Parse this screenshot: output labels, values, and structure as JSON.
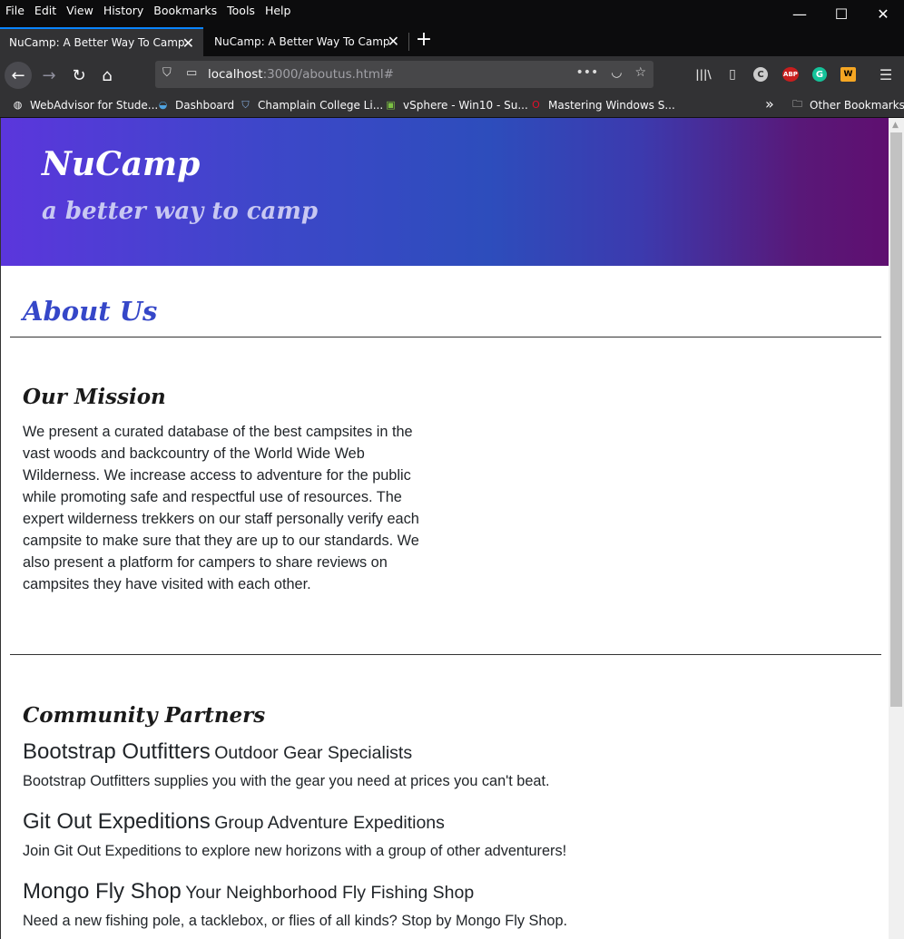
{
  "menu": [
    "File",
    "Edit",
    "View",
    "History",
    "Bookmarks",
    "Tools",
    "Help"
  ],
  "window_controls": {
    "minimize": "—",
    "maximize": "☐",
    "close": "✕"
  },
  "tabs": [
    {
      "title": "NuCamp: A Better Way To Camp",
      "active": true
    },
    {
      "title": "NuCamp: A Better Way To Camp",
      "active": false
    }
  ],
  "new_tab_label": "+",
  "address": {
    "host": "localhost",
    "rest": ":3000/aboutus.html#"
  },
  "url_actions": {
    "more": "•••",
    "pocket": "◡",
    "star": "☆"
  },
  "toolbar_icons": [
    "library-icon",
    "sidebar-icon",
    "extension-c-icon",
    "adblock-plus-icon",
    "grammarly-icon",
    "wappalyzer-icon",
    "menu-icon"
  ],
  "toolbar_icon_text": {
    "c": "C",
    "abp": "ABP",
    "g": "G",
    "w": "W",
    "menu": "☰",
    "library": "|||\\",
    "sidebar": "▯"
  },
  "bookmarks": [
    {
      "label": "WebAdvisor for Stude...",
      "icon": "globe-icon"
    },
    {
      "label": "Dashboard",
      "icon": "dashboard-icon"
    },
    {
      "label": "Champlain College Li...",
      "icon": "shield-icon"
    },
    {
      "label": "vSphere - Win10 - Su...",
      "icon": "vsphere-icon"
    },
    {
      "label": "Mastering Windows S...",
      "icon": "opera-icon"
    }
  ],
  "bookmarks_overflow": "»",
  "other_bookmarks": "Other Bookmarks",
  "page": {
    "brand": "NuCamp",
    "tagline": "a better way to camp",
    "heading": "About Us",
    "mission_heading": "Our Mission",
    "mission_text": "We present a curated database of the best campsites in the vast woods and backcountry of the World Wide Web Wilderness. We increase access to adventure for the public while promoting safe and respectful use of resources. The expert wilderness trekkers on our staff personally verify each campsite to make sure that they are up to our standards. We also present a platform for campers to share reviews on campsites they have visited with each other.",
    "partners_heading": "Community Partners",
    "partners": [
      {
        "name": "Bootstrap Outfitters",
        "subtitle": "Outdoor Gear Specialists",
        "text": "Bootstrap Outfitters supplies you with the gear you need at prices you can't beat."
      },
      {
        "name": "Git Out Expeditions",
        "subtitle": "Group Adventure Expeditions",
        "text": "Join Git Out Expeditions to explore new horizons with a group of other adventurers!"
      },
      {
        "name": "Mongo Fly Shop",
        "subtitle": "Your Neighborhood Fly Fishing Shop",
        "text": "Need a new fishing pole, a tacklebox, or flies of all kinds? Stop by Mongo Fly Shop."
      }
    ]
  },
  "colors": {
    "accent_tab": "#0a84ff",
    "heading_blue": "#3547c8",
    "jumbotron_gradient": [
      "#5b36dc",
      "#2d4dbc",
      "#5f0f70"
    ]
  }
}
